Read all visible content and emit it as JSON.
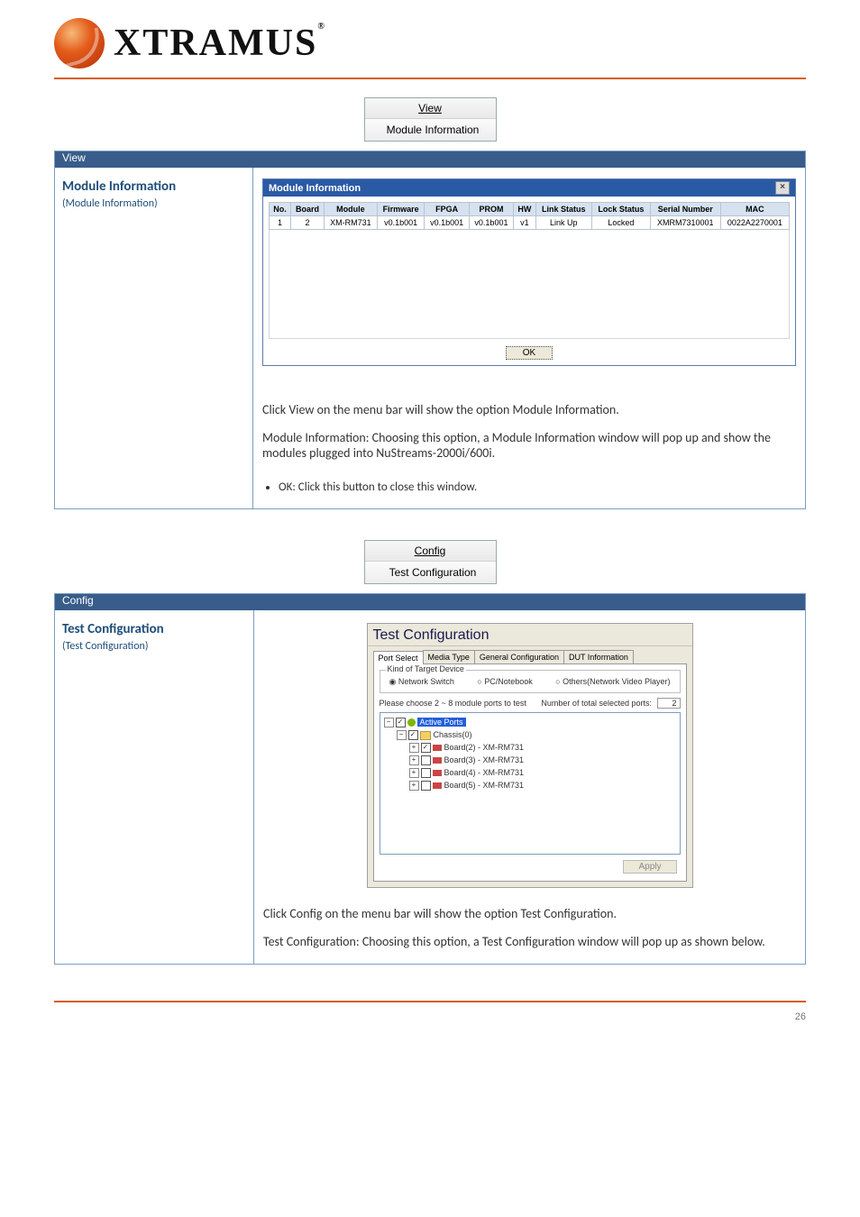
{
  "logo": {
    "text": "XTRAMUS",
    "tm": "®"
  },
  "menus": {
    "view": {
      "label": "View",
      "item": "Module Information"
    },
    "config": {
      "label": "Config",
      "item": "Test Configuration"
    }
  },
  "sections": {
    "view": {
      "title": "View",
      "left": {
        "title": "Module Information",
        "sub": "(Module Information)"
      },
      "desc_top": "Click View on the menu bar will show the option Module Information.",
      "desc_mid": "Module Information: Choosing this option, a Module Information window will pop up and show the modules plugged into NuStreams-2000i/600i.",
      "bullet": "OK: Click this button to close this window."
    },
    "config": {
      "title": "Config",
      "left": {
        "title": "Test Configuration",
        "sub": "(Test Configuration)"
      },
      "desc_top": "Click Config on the menu bar will show the option Test Configuration.",
      "desc_mid": "Test Configuration: Choosing this option, a Test Configuration window will pop up as shown below."
    }
  },
  "mi_window": {
    "title": "Module Information",
    "headers": [
      "No.",
      "Board",
      "Module",
      "Firmware",
      "FPGA",
      "PROM",
      "HW",
      "Link Status",
      "Lock Status",
      "Serial Number",
      "MAC"
    ],
    "row": [
      "1",
      "2",
      "XM-RM731",
      "v0.1b001",
      "v0.1b001",
      "v0.1b001",
      "v1",
      "Link Up",
      "Locked",
      "XMRM7310001",
      "0022A2270001"
    ],
    "ok": "OK"
  },
  "tc_window": {
    "title": "Test Configuration",
    "tabs": [
      "Port Select",
      "Media Type",
      "General Configuration",
      "DUT Information"
    ],
    "group_title": "Kind of Target Device",
    "radios": [
      "Network Switch",
      "PC/Notebook",
      "Others(Network Video Player)"
    ],
    "tree_instr": "Please choose 2 ~ 8 module ports to test",
    "num_label": "Number of total selected ports:",
    "num_value": "2",
    "tree": {
      "root": "Active Ports",
      "chassis": "Chassis(0)",
      "boards": [
        {
          "label": "Board(2) - XM-RM731",
          "checked": true
        },
        {
          "label": "Board(3) - XM-RM731",
          "checked": false
        },
        {
          "label": "Board(4) - XM-RM731",
          "checked": false
        },
        {
          "label": "Board(5) - XM-RM731",
          "checked": false
        }
      ]
    },
    "apply": "Apply"
  },
  "footer": {
    "left": "",
    "right": "26"
  }
}
